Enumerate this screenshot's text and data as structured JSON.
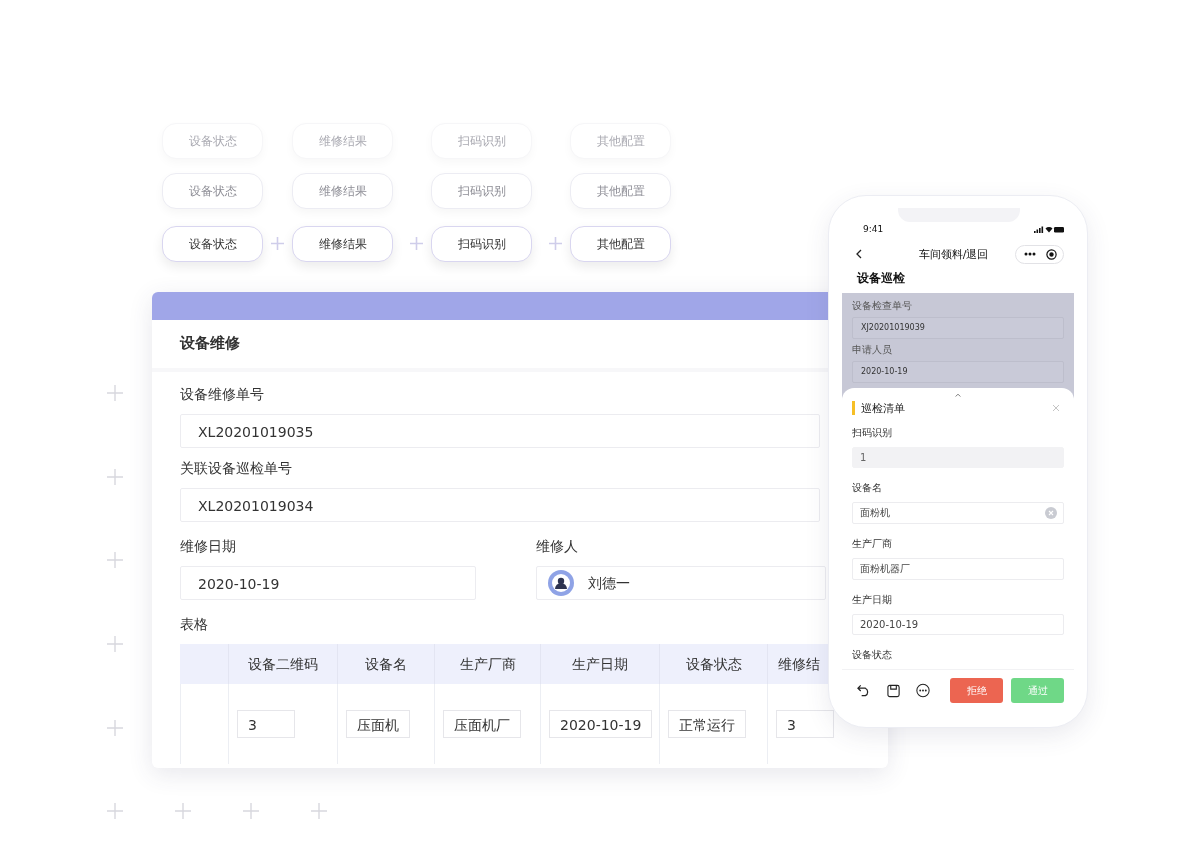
{
  "option_rows": [
    {
      "kind": "faint",
      "options": [
        "设备状态",
        "维修结果",
        "扫码识别",
        "其他配置"
      ]
    },
    {
      "kind": "light",
      "options": [
        "设备状态",
        "维修结果",
        "扫码识别",
        "其他配置"
      ]
    },
    {
      "kind": "normal",
      "options": [
        "设备状态",
        "维修结果",
        "扫码识别",
        "其他配置"
      ]
    }
  ],
  "form": {
    "title": "设备维修",
    "order_label": "设备维修单号",
    "order_value": "XL20201019035",
    "related_label": "关联设备巡检单号",
    "related_value": "XL20201019034",
    "date_label": "维修日期",
    "date_value": "2020-10-19",
    "repairer_label": "维修人",
    "repairer_value": "刘德一",
    "table_label": "表格",
    "table": {
      "columns": [
        "设备二维码",
        "设备名",
        "生产厂商",
        "生产日期",
        "设备状态",
        "维修结"
      ],
      "rows": [
        [
          "3",
          "压面机",
          "压面机厂",
          "2020-10-19",
          "正常运行",
          "3"
        ]
      ]
    }
  },
  "phone": {
    "time": "9:41",
    "nav_title": "车间领料/退回",
    "page_title": "设备巡检",
    "background_fields": [
      {
        "label": "设备检查单号",
        "value": "XJ20201019039"
      },
      {
        "label": "申请人员",
        "value": "2020-10-19"
      }
    ],
    "sheet": {
      "title": "巡检清单",
      "fields": [
        {
          "label": "扫码识别",
          "value": "1",
          "disabled": true,
          "clearable": false
        },
        {
          "label": "设备名",
          "value": "面粉机",
          "disabled": false,
          "clearable": true
        },
        {
          "label": "生产厂商",
          "value": "面粉机器厂",
          "disabled": false,
          "clearable": false
        },
        {
          "label": "生产日期",
          "value": "2020-10-19",
          "disabled": false,
          "clearable": false
        }
      ],
      "trailing_label": "设备状态"
    },
    "buttons": [
      {
        "label": "拒绝",
        "kind": "reject"
      },
      {
        "label": "通过",
        "kind": "approve"
      }
    ]
  }
}
